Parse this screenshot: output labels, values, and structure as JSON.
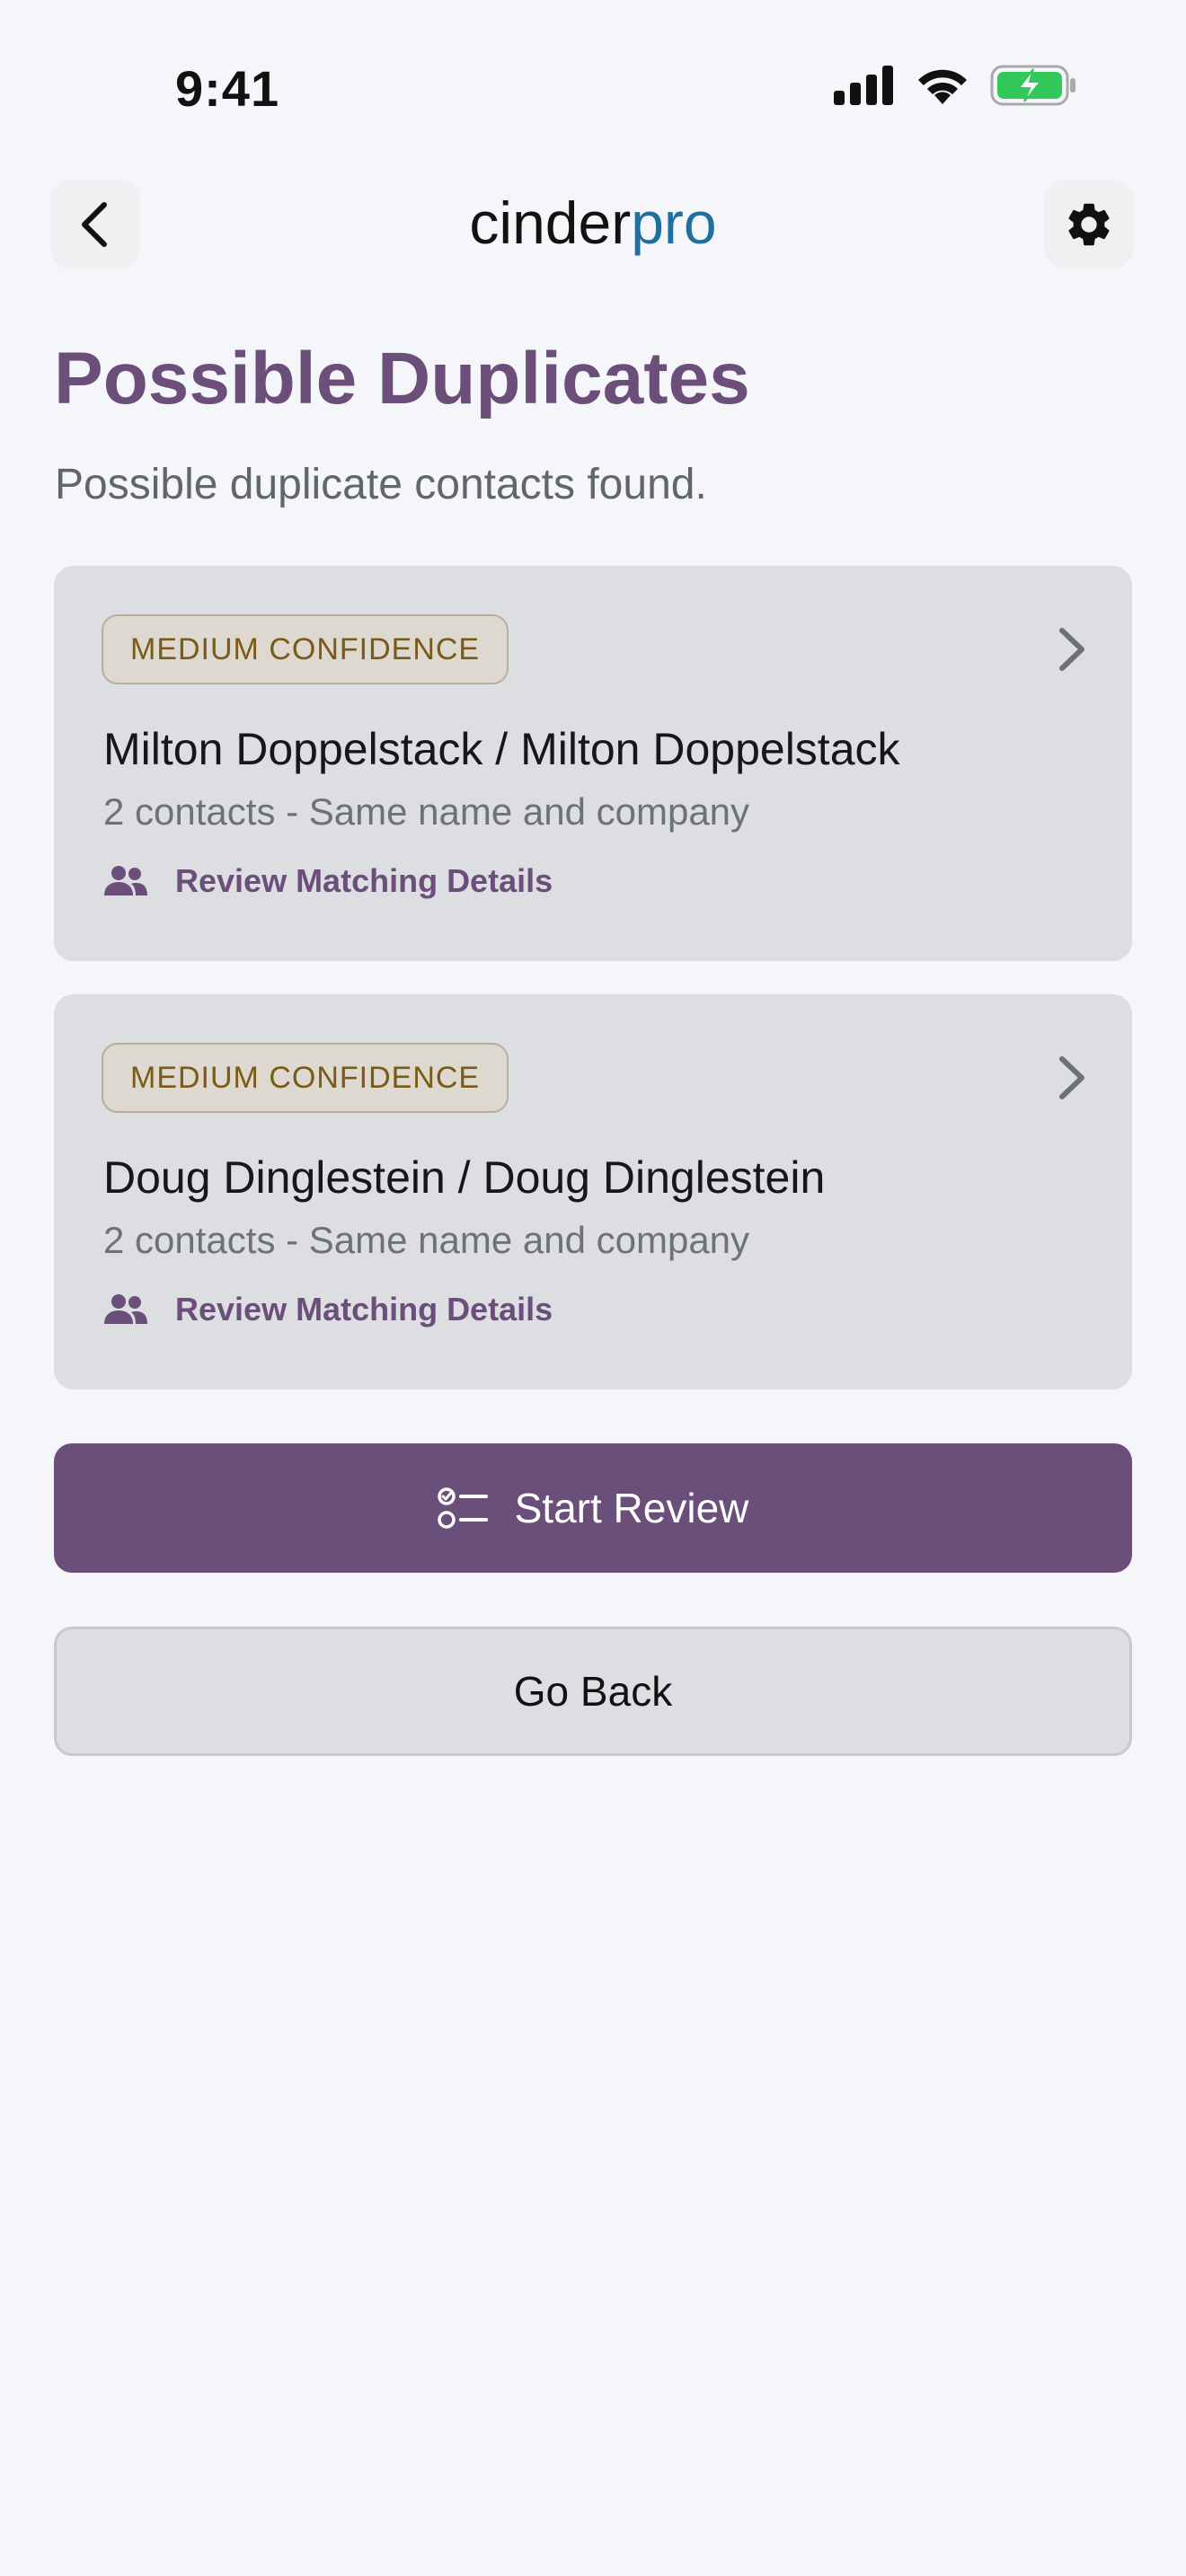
{
  "status_bar": {
    "time": "9:41",
    "icons": [
      "signal-icon",
      "wifi-icon",
      "battery-charging-icon"
    ]
  },
  "nav": {
    "back_icon": "chevron-left-icon",
    "logo_part1": "cinder",
    "logo_part2": "pro",
    "settings_icon": "gear-icon"
  },
  "page": {
    "title": "Possible Duplicates",
    "subtitle": "Possible duplicate contacts found."
  },
  "duplicates": [
    {
      "badge": "MEDIUM CONFIDENCE",
      "title": "Milton Doppelstack / Milton Doppelstack",
      "subtitle": "2 contacts - Same name and company",
      "link_label": "Review Matching Details"
    },
    {
      "badge": "MEDIUM CONFIDENCE",
      "title": "Doug Dinglestein / Doug Dinglestein",
      "subtitle": "2 contacts - Same name and company",
      "link_label": "Review Matching Details"
    }
  ],
  "actions": {
    "start_review_label": "Start Review",
    "go_back_label": "Go Back"
  },
  "colors": {
    "accent": "#6a4f7b",
    "logo_accent": "#1f6fa0",
    "badge_text": "#7a5a17",
    "battery_green": "#34c759"
  }
}
